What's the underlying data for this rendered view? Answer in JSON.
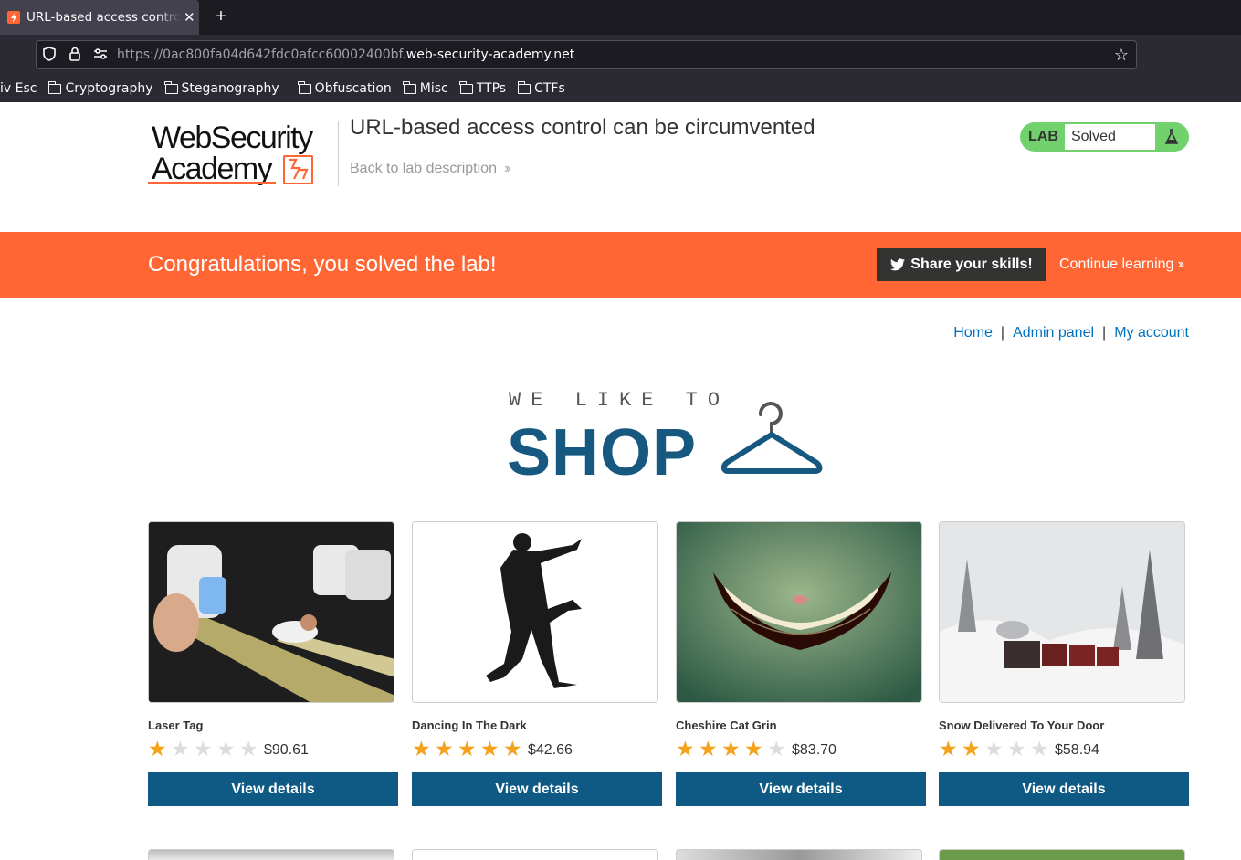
{
  "browser": {
    "tab_title": "URL-based access control can be circumvented",
    "url_prefix": "https://0ac800fa04d642fdc0afcc60002400bf.",
    "url_domain": "web-security-academy.net",
    "bookmarks": [
      "iv Esc",
      "Cryptography",
      "Steganography",
      "Obfuscation",
      "Misc",
      "TTPs",
      "CTFs"
    ]
  },
  "header": {
    "logo_line1": "WebSecurity",
    "logo_line2": "Academy",
    "lab_title": "URL-based access control can be circumvented",
    "back_link": "Back to lab description",
    "lab_badge": "LAB",
    "lab_status": "Solved",
    "solved_color": "#70d16d"
  },
  "banner": {
    "message": "Congratulations, you solved the lab!",
    "share_label": "Share your skills!",
    "continue_label": "Continue learning",
    "color": "#ff6633"
  },
  "nav": {
    "home": "Home",
    "admin": "Admin panel",
    "account": "My account"
  },
  "shop_logo": {
    "tagline": "WE LIKE TO",
    "word": "SHOP"
  },
  "products": [
    {
      "name": "Laser Tag",
      "rating": 1,
      "price": "$90.61",
      "button": "View details"
    },
    {
      "name": "Dancing In The Dark",
      "rating": 5,
      "price": "$42.66",
      "button": "View details"
    },
    {
      "name": "Cheshire Cat Grin",
      "rating": 4,
      "price": "$83.70",
      "button": "View details"
    },
    {
      "name": "Snow Delivered To Your Door",
      "rating": 2,
      "price": "$58.94",
      "button": "View details"
    }
  ]
}
